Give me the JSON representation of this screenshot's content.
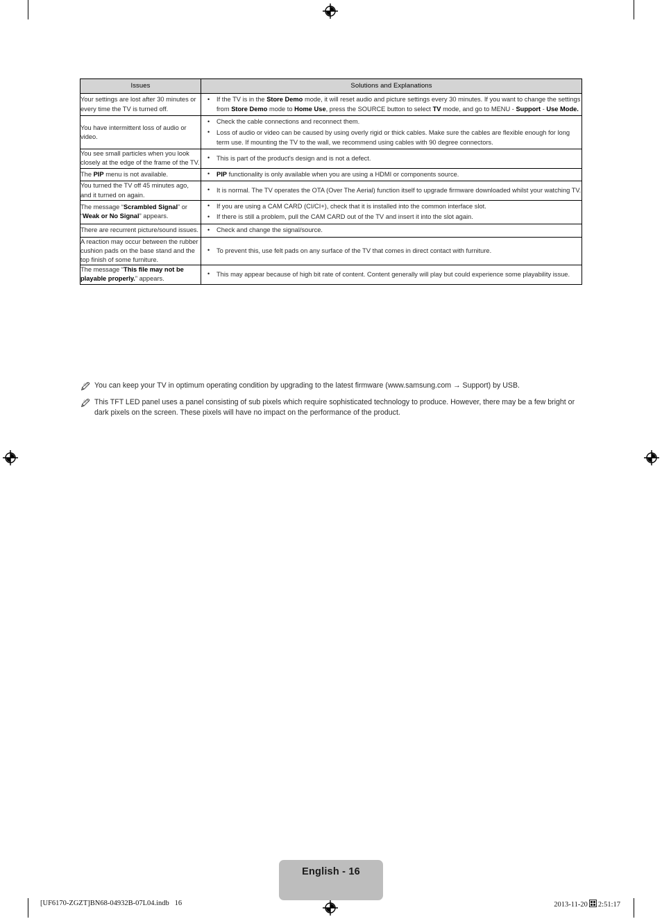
{
  "document": {
    "type": "samsung-tv-user-manual-troubleshooting-page",
    "page_label": "English - 16"
  },
  "table": {
    "headers": {
      "issues": "Issues",
      "solutions": "Solutions and Explanations"
    },
    "rows": [
      {
        "issue_html": "Your settings are lost after 30 minutes or every time the TV is turned off.",
        "solutions_html": [
          "If the TV is in the <b>Store Demo</b> mode, it will reset audio and picture settings every 30 minutes. If you want to change the settings from <b>Store Demo</b> mode to <b>Home Use</b>, press the SOURCE button to select <b>TV</b> mode, and go to MENU - <b>Support</b> - <b>Use Mode.</b>"
        ]
      },
      {
        "issue_html": "You have intermittent loss of audio or video.",
        "solutions_html": [
          "Check the cable connections and reconnect them.",
          "Loss of audio or video can be caused by using overly rigid or thick cables. Make sure the cables are flexible enough for long term use. If mounting the TV to the wall, we recommend using cables with 90 degree connectors."
        ]
      },
      {
        "issue_html": "You see small particles when you look closely at the edge of the frame of the TV.",
        "solutions_html": [
          "This is part of the product's design and is not a defect."
        ]
      },
      {
        "issue_html": "The <b>PIP</b> menu is not available.",
        "solutions_html": [
          "<b>PIP</b> functionality is only available when you are using a HDMI or components source."
        ]
      },
      {
        "issue_html": "You turned the TV off 45 minutes ago, and it turned on again.",
        "solutions_html": [
          "It is normal. The TV operates the OTA (Over The Aerial) function itself to upgrade firmware downloaded whilst your watching TV."
        ]
      },
      {
        "issue_html": "The message “<b>Scrambled Signal</b>” or “<b>Weak or No Signal</b>” appears.",
        "solutions_html": [
          "If you are using a CAM CARD (CI/CI+), check that it is installed into the common interface slot.",
          "If there is still a problem, pull the CAM CARD out of the TV and insert it into the slot again."
        ]
      },
      {
        "issue_html": "There are recurrent picture/sound issues.",
        "solutions_html": [
          "Check and change the signal/source."
        ]
      },
      {
        "issue_html": "A reaction may occur between the rubber cushion pads on the base stand and the top finish of some furniture.",
        "solutions_html": [
          "To prevent this, use felt pads on any surface of the TV that comes in direct contact with furniture."
        ]
      },
      {
        "issue_html": "The message “<b>This file may not be playable properly.</b>” appears.",
        "solutions_html": [
          "This may appear because of high bit rate of content. Content generally will play but could experience some playability issue."
        ]
      }
    ]
  },
  "notes": [
    {
      "icon": "note-pencil-icon",
      "text": "You can keep your TV in optimum operating condition by upgrading to the latest firmware (www.samsung.com → Support) by USB."
    },
    {
      "icon": "note-pencil-icon",
      "text": "This TFT LED panel uses a panel consisting of sub pixels which require sophisticated technology to produce. However, there may be a few bright or dark pixels on the screen. These pixels will have no impact on the performance of the product."
    }
  ],
  "footer": {
    "page_badge": "English - 16",
    "left_text": "[UF6170-ZGZT]BN68-04932B-07L04.indb   16",
    "right_date": "2013-11-20",
    "right_time": "2:51:17"
  },
  "colors": {
    "header_gray": "#d4d4d4",
    "badge_gray": "#bdbdbd",
    "text": "#2a2a2a",
    "rule": "#000000"
  }
}
